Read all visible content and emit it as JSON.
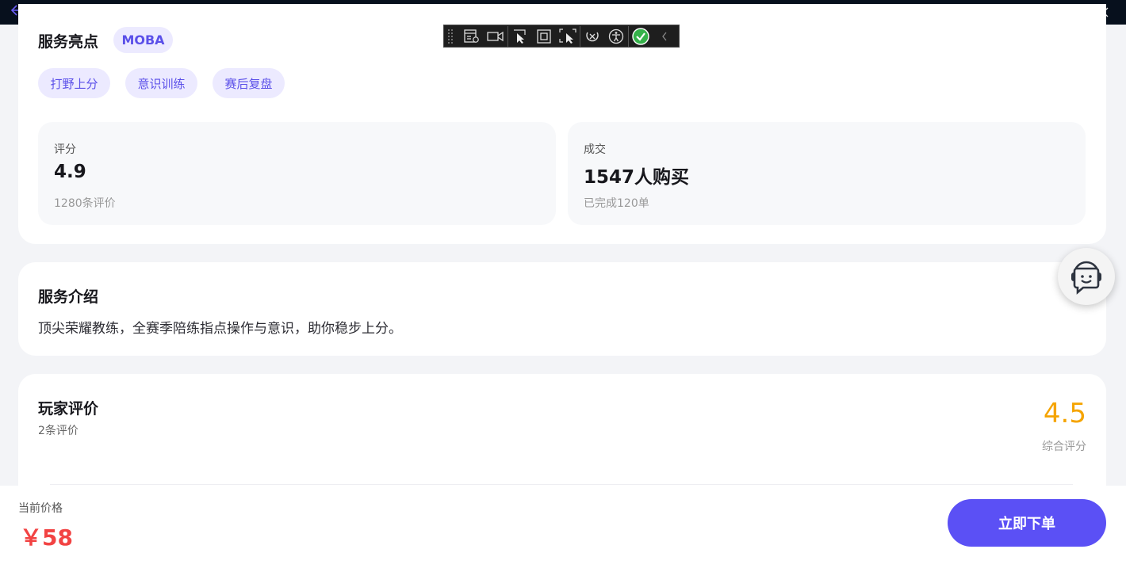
{
  "highlights": {
    "title": "服务亮点",
    "category_badge": "MOBA",
    "tags": [
      "打野上分",
      "意识训练",
      "赛后复盘"
    ]
  },
  "stats": {
    "rating": {
      "label": "评分",
      "value": "4.9",
      "sub": "1280条评价"
    },
    "sales": {
      "label": "成交",
      "value": "1547人购买",
      "sub": "已完成120单"
    }
  },
  "intro": {
    "title": "服务介绍",
    "text": "顶尖荣耀教练，全赛季陪练指点操作与意识，助你稳步上分。"
  },
  "reviews": {
    "title": "玩家评价",
    "count": "2条评价",
    "score": "4.5",
    "score_label": "综合评分"
  },
  "bottom": {
    "price_label": "当前价格",
    "price": "￥58",
    "order_button": "立即下单"
  },
  "icons": {
    "back": "back-arrow-icon",
    "support": "customer-service-icon"
  },
  "colors": {
    "accent": "#5b50f5",
    "price": "#f24343",
    "score": "#f5a400",
    "tag_bg": "#eceaff"
  }
}
